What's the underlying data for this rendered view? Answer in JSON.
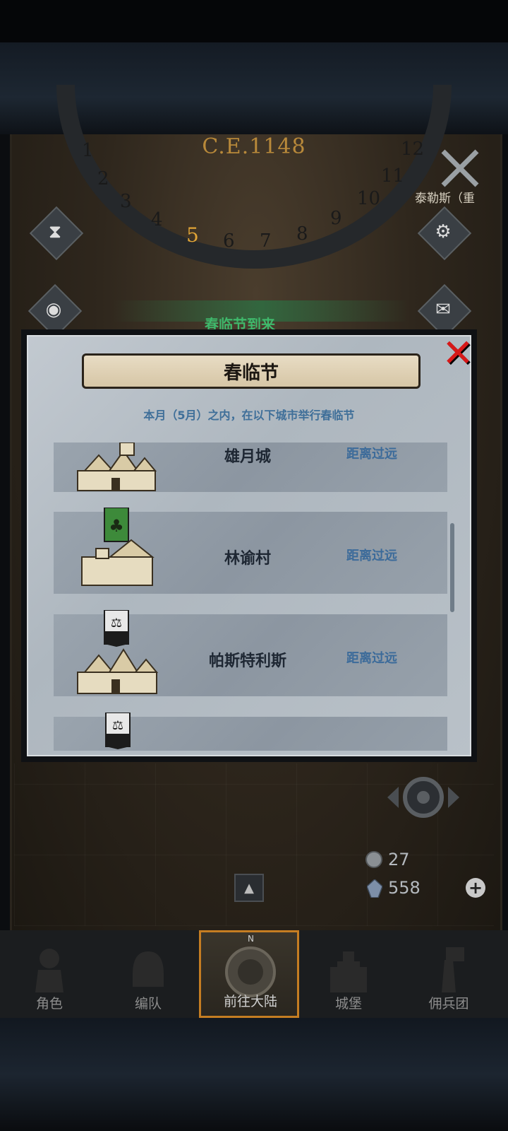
{
  "map": {
    "year": "C.E.1148",
    "months_visible": [
      "1",
      "2",
      "3",
      "4",
      "5",
      "6",
      "7",
      "8",
      "9",
      "10",
      "11",
      "12"
    ],
    "current_month": "5",
    "location_label": "泰勒斯（重",
    "event_banner": "春临节到来"
  },
  "dialog": {
    "title": "春临节",
    "subtitle": "本月（5月）之内，在以下城市举行春临节",
    "rows": [
      {
        "name": "雄月城",
        "status": "距离过远",
        "banner": "none",
        "building": "castle"
      },
      {
        "name": "林谕村",
        "status": "距离过远",
        "banner": "tree",
        "building": "village"
      },
      {
        "name": "帕斯特利斯",
        "status": "距离过远",
        "banner": "scales",
        "building": "castle"
      },
      {
        "name": "",
        "status": "",
        "banner": "scales",
        "building": "castle"
      }
    ]
  },
  "resources": {
    "silver": "27",
    "crystal": "558"
  },
  "nav": {
    "items": [
      {
        "label": "角色",
        "icon": "knight-icon"
      },
      {
        "label": "编队",
        "icon": "helmet-icon"
      },
      {
        "label": "前往大陆",
        "icon": "compass-icon",
        "selected": true
      },
      {
        "label": "城堡",
        "icon": "castle-icon"
      },
      {
        "label": "佣兵团",
        "icon": "mercenary-icon"
      }
    ],
    "compass_letter": "N"
  },
  "colors": {
    "accent_selected": "#c57d22",
    "close_red": "#d71818",
    "status_blue": "#3c6b9a",
    "event_green": "#3fb86b"
  }
}
